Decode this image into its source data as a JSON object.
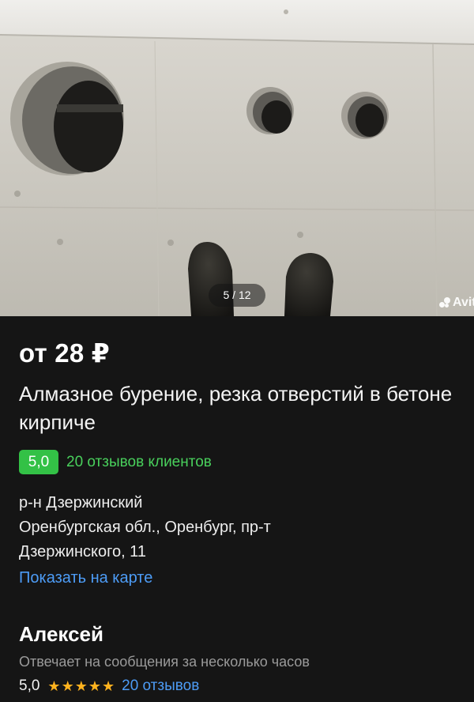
{
  "gallery": {
    "counter": "5 / 12",
    "watermark": "Avit"
  },
  "listing": {
    "price": "от 28 ₽",
    "title": "Алмазное бурение, резка отверстий в бетоне кирпиче",
    "rating": "5,0",
    "reviews_link": "20 отзывов клиентов",
    "address_lines": [
      "р-н Дзержинский",
      "Оренбургская обл., Оренбург, пр-т",
      "Дзержинского, 11"
    ],
    "map_link": "Показать на карте"
  },
  "seller": {
    "name": "Алексей",
    "response_time": "Отвечает на сообщения за несколько часов",
    "rating": "5,0",
    "stars": 5,
    "reviews_link": "20 отзывов"
  },
  "colors": {
    "background": "#151515",
    "rating_badge": "#33c146",
    "rating_link": "#49d05c",
    "link": "#4d9cf6",
    "star": "#ffb21e"
  },
  "icons": [
    "star-icon",
    "avito-logo-icon"
  ]
}
